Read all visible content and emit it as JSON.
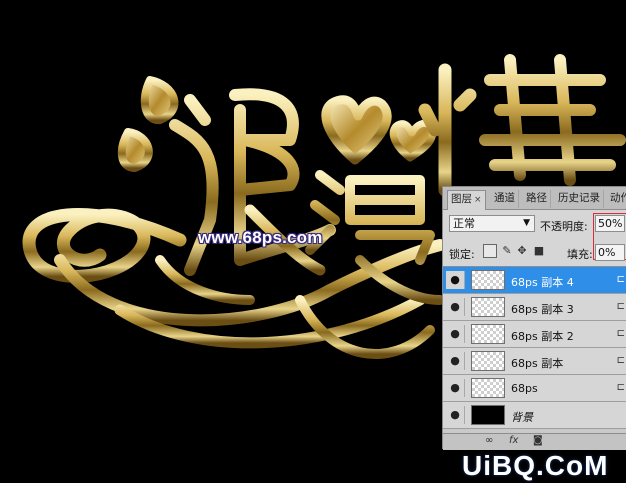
{
  "artwork": {
    "watermark_url": "www.68ps.com",
    "site_logo": "UiBQ.CoM",
    "colors": {
      "gold_light": "#f4e6a8",
      "gold_mid": "#c8a24a",
      "gold_dark": "#6b4e14",
      "background": "#000000"
    }
  },
  "panel": {
    "tabs": [
      {
        "label": "图层",
        "close": "×",
        "active": true
      },
      {
        "label": "通道"
      },
      {
        "label": "路径"
      },
      {
        "label": "历史记录"
      },
      {
        "label": "动作"
      }
    ],
    "blend_mode": "正常",
    "opacity_label": "不透明度:",
    "opacity_value": "50%",
    "lock_label": "锁定:",
    "fill_label": "填充:",
    "fill_value": "0%",
    "layers": [
      {
        "name": "68ps 副本 4",
        "selected": true,
        "thumb": "transparent"
      },
      {
        "name": "68ps 副本 3",
        "thumb": "transparent"
      },
      {
        "name": "68ps 副本 2",
        "thumb": "transparent"
      },
      {
        "name": "68ps  副本",
        "thumb": "transparent"
      },
      {
        "name": "68ps",
        "thumb": "transparent"
      },
      {
        "name": "背景",
        "thumb": "black",
        "italic": true
      }
    ],
    "highlight_color": "#e0283a",
    "selection_color": "#2f8fe8",
    "icons": [
      "eye-icon",
      "link-icon",
      "fx-icon",
      "mask-icon",
      "lock-icon",
      "brush-icon",
      "move-icon"
    ]
  }
}
